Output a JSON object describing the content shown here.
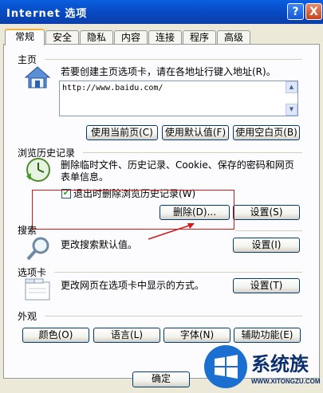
{
  "window": {
    "title": "Internet 选项",
    "help_glyph": "?",
    "close_glyph": "X"
  },
  "tabs": [
    "常规",
    "安全",
    "隐私",
    "内容",
    "连接",
    "程序",
    "高级"
  ],
  "home": {
    "section": "主页",
    "desc": "若要创建主页选项卡，请在各地址行键入地址(R)。",
    "url": "http://www.baidu.com/",
    "buttons": [
      "使用当前页(C)",
      "使用默认值(F)",
      "使用空白页(B)"
    ]
  },
  "history": {
    "section": "浏览历史记录",
    "desc": "删除临时文件、历史记录、Cookie、保存的密码和网页表单信息。",
    "checkbox_label": "退出时删除浏览历史记录(W)",
    "checkbox_checked": true,
    "delete_button": "删除(D)...",
    "settings_button": "设置(S)"
  },
  "search": {
    "section": "搜索",
    "desc": "更改搜索默认值。",
    "settings_button": "设置(I)"
  },
  "tabsec": {
    "section": "选项卡",
    "desc": "更改网页在选项卡中显示的方式。",
    "settings_button": "设置(T)"
  },
  "appearance": {
    "section": "外观",
    "buttons": [
      "颜色(O)",
      "语言(L)",
      "字体(N)",
      "辅助功能(E)"
    ]
  },
  "footer": {
    "ok_button": "确定"
  },
  "watermark": {
    "brand": "系统族",
    "url": "WWW.XITONGZU.COM"
  },
  "colors": {
    "titlebar": "#0a5fe0",
    "annotation": "#d11a1a",
    "window_bg": "#ece9d8"
  }
}
